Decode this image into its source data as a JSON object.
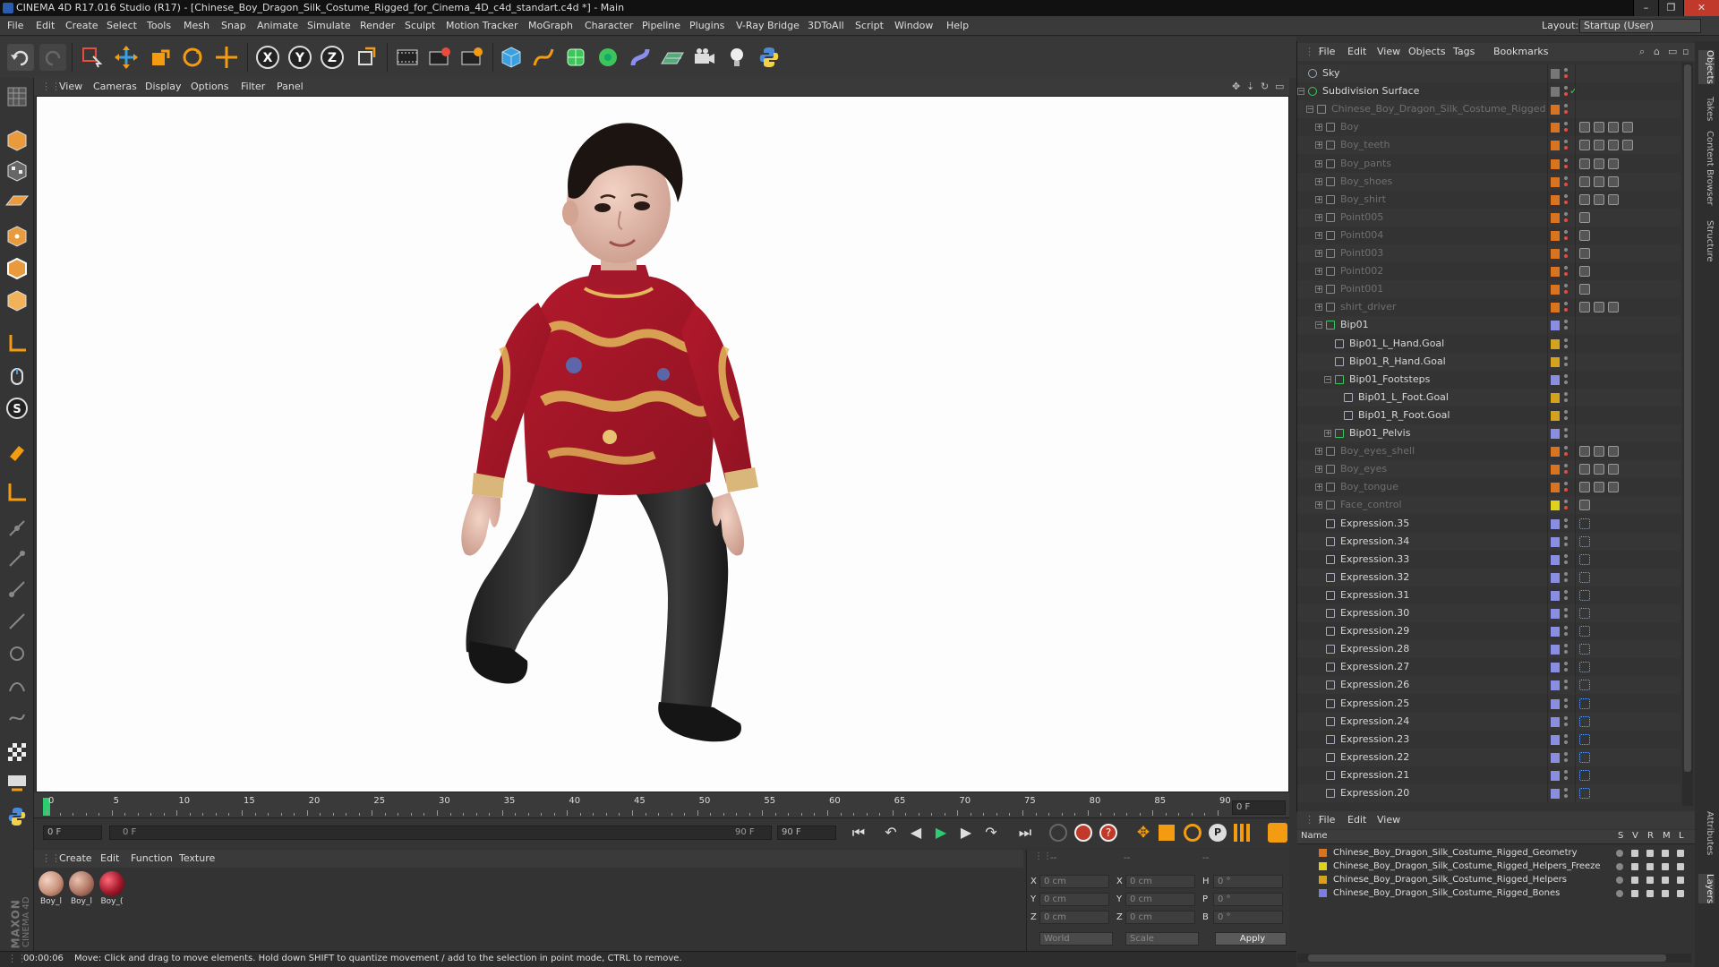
{
  "window": {
    "title": "CINEMA 4D R17.016 Studio (R17) - [Chinese_Boy_Dragon_Silk_Costume_Rigged_for_Cinema_4D_c4d_standart.c4d *] - Main",
    "minimize": "–",
    "maximize": "❐",
    "close": "✕"
  },
  "menubar": {
    "items": [
      "File",
      "Edit",
      "Create",
      "Select",
      "Tools",
      "Mesh",
      "Snap",
      "Animate",
      "Simulate",
      "Render",
      "Sculpt",
      "Motion Tracker",
      "MoGraph",
      "Character",
      "Pipeline",
      "Plugins",
      "V-Ray Bridge",
      "3DToAll",
      "Script",
      "Window",
      "Help"
    ],
    "layout_label": "Layout:",
    "layout_value": "Startup (User)"
  },
  "viewport": {
    "menu": [
      "View",
      "Cameras",
      "Display",
      "Options",
      "Filter",
      "Panel"
    ]
  },
  "timeline": {
    "ticks": [
      "0",
      "5",
      "10",
      "15",
      "20",
      "25",
      "30",
      "35",
      "40",
      "45",
      "50",
      "55",
      "60",
      "65",
      "70",
      "75",
      "80",
      "85",
      "90"
    ],
    "current_frame": "0 F",
    "start_field": "0 F",
    "range_start": "0 F",
    "range_end": "90 F",
    "end_field": "90 F"
  },
  "material_manager": {
    "menu": [
      "Create",
      "Edit",
      "Function",
      "Texture"
    ],
    "materials": [
      {
        "label": "Boy_l",
        "color": "#c8927a"
      },
      {
        "label": "Boy_l",
        "color": "#b07563"
      },
      {
        "label": "Boy_(",
        "color": "#a0182a"
      }
    ]
  },
  "coordinates": {
    "header_left": "--",
    "header_mid": "--",
    "header_right": "--",
    "rows": [
      {
        "a": "X",
        "av": "0 cm",
        "b": "X",
        "bv": "0 cm",
        "c": "H",
        "cv": "0 °"
      },
      {
        "a": "Y",
        "av": "0 cm",
        "b": "Y",
        "bv": "0 cm",
        "c": "P",
        "cv": "0 °"
      },
      {
        "a": "Z",
        "av": "0 cm",
        "b": "Z",
        "bv": "0 cm",
        "c": "B",
        "cv": "0 °"
      }
    ],
    "space": "World",
    "mode": "Scale",
    "apply": "Apply"
  },
  "status": {
    "time": "00:00:06",
    "message": "Move: Click and drag to move elements. Hold down SHIFT to quantize movement / add to the selection in point mode, CTRL to remove."
  },
  "brand": {
    "maxon": "MAXON",
    "cinema": "CINEMA 4D"
  },
  "object_manager": {
    "menu": [
      "File",
      "Edit",
      "View",
      "Objects",
      "Tags",
      "Bookmarks"
    ],
    "objects": [
      {
        "name": "Sky",
        "depth": 0,
        "dim": false,
        "exp": "",
        "color": "#9ab"
      },
      {
        "name": "Subdivision Surface",
        "depth": 0,
        "dim": false,
        "exp": "−",
        "color": "#3ec45c"
      },
      {
        "name": "Chinese_Boy_Dragon_Silk_Costume_Rigged",
        "depth": 1,
        "dim": true,
        "exp": "−",
        "color": "#888"
      },
      {
        "name": "Boy",
        "depth": 2,
        "dim": true,
        "exp": "+",
        "color": "#888"
      },
      {
        "name": "Boy_teeth",
        "depth": 2,
        "dim": true,
        "exp": "+",
        "color": "#888"
      },
      {
        "name": "Boy_pants",
        "depth": 2,
        "dim": true,
        "exp": "+",
        "color": "#888"
      },
      {
        "name": "Boy_shoes",
        "depth": 2,
        "dim": true,
        "exp": "+",
        "color": "#888"
      },
      {
        "name": "Boy_shirt",
        "depth": 2,
        "dim": true,
        "exp": "+",
        "color": "#888"
      },
      {
        "name": "Point005",
        "depth": 2,
        "dim": true,
        "exp": "+",
        "color": "#888"
      },
      {
        "name": "Point004",
        "depth": 2,
        "dim": true,
        "exp": "+",
        "color": "#888"
      },
      {
        "name": "Point003",
        "depth": 2,
        "dim": true,
        "exp": "+",
        "color": "#888"
      },
      {
        "name": "Point002",
        "depth": 2,
        "dim": true,
        "exp": "+",
        "color": "#888"
      },
      {
        "name": "Point001",
        "depth": 2,
        "dim": true,
        "exp": "+",
        "color": "#888"
      },
      {
        "name": "shirt_driver",
        "depth": 2,
        "dim": true,
        "exp": "+",
        "color": "#888"
      },
      {
        "name": "Bip01",
        "depth": 2,
        "dim": false,
        "exp": "−",
        "color": "#3ec45c"
      },
      {
        "name": "Bip01_L_Hand.Goal",
        "depth": 3,
        "dim": false,
        "exp": "",
        "color": "#aab"
      },
      {
        "name": "Bip01_R_Hand.Goal",
        "depth": 3,
        "dim": false,
        "exp": "",
        "color": "#aab"
      },
      {
        "name": "Bip01_Footsteps",
        "depth": 3,
        "dim": false,
        "exp": "−",
        "color": "#3ec45c"
      },
      {
        "name": "Bip01_L_Foot.Goal",
        "depth": 4,
        "dim": false,
        "exp": "",
        "color": "#aab"
      },
      {
        "name": "Bip01_R_Foot.Goal",
        "depth": 4,
        "dim": false,
        "exp": "",
        "color": "#aab"
      },
      {
        "name": "Bip01_Pelvis",
        "depth": 3,
        "dim": false,
        "exp": "+",
        "color": "#3ec45c"
      },
      {
        "name": "Boy_eyes_shell",
        "depth": 2,
        "dim": true,
        "exp": "+",
        "color": "#888"
      },
      {
        "name": "Boy_eyes",
        "depth": 2,
        "dim": true,
        "exp": "+",
        "color": "#888"
      },
      {
        "name": "Boy_tongue",
        "depth": 2,
        "dim": true,
        "exp": "+",
        "color": "#888"
      },
      {
        "name": "Face_control",
        "depth": 2,
        "dim": true,
        "exp": "+",
        "color": "#888"
      },
      {
        "name": "Expression.35",
        "depth": 2,
        "dim": false,
        "exp": "",
        "color": "#aab"
      },
      {
        "name": "Expression.34",
        "depth": 2,
        "dim": false,
        "exp": "",
        "color": "#aab"
      },
      {
        "name": "Expression.33",
        "depth": 2,
        "dim": false,
        "exp": "",
        "color": "#aab"
      },
      {
        "name": "Expression.32",
        "depth": 2,
        "dim": false,
        "exp": "",
        "color": "#aab"
      },
      {
        "name": "Expression.31",
        "depth": 2,
        "dim": false,
        "exp": "",
        "color": "#aab"
      },
      {
        "name": "Expression.30",
        "depth": 2,
        "dim": false,
        "exp": "",
        "color": "#aab"
      },
      {
        "name": "Expression.29",
        "depth": 2,
        "dim": false,
        "exp": "",
        "color": "#aab"
      },
      {
        "name": "Expression.28",
        "depth": 2,
        "dim": false,
        "exp": "",
        "color": "#aab"
      },
      {
        "name": "Expression.27",
        "depth": 2,
        "dim": false,
        "exp": "",
        "color": "#aab"
      },
      {
        "name": "Expression.26",
        "depth": 2,
        "dim": false,
        "exp": "",
        "color": "#aab"
      },
      {
        "name": "Expression.25",
        "depth": 2,
        "dim": false,
        "exp": "",
        "color": "#aab"
      },
      {
        "name": "Expression.24",
        "depth": 2,
        "dim": false,
        "exp": "",
        "color": "#aab"
      },
      {
        "name": "Expression.23",
        "depth": 2,
        "dim": false,
        "exp": "",
        "color": "#aab"
      },
      {
        "name": "Expression.22",
        "depth": 2,
        "dim": false,
        "exp": "",
        "color": "#aab"
      },
      {
        "name": "Expression.21",
        "depth": 2,
        "dim": false,
        "exp": "",
        "color": "#aab"
      },
      {
        "name": "Expression.20",
        "depth": 2,
        "dim": false,
        "exp": "",
        "color": "#aab"
      }
    ]
  },
  "layer_manager": {
    "menu": [
      "File",
      "Edit",
      "View"
    ],
    "columns": {
      "name": "Name",
      "s": "S",
      "v": "V",
      "r": "R",
      "m": "M",
      "l": "L"
    },
    "layers": [
      {
        "name": "Chinese_Boy_Dragon_Silk_Costume_Rigged_Geometry",
        "color": "#d9731f"
      },
      {
        "name": "Chinese_Boy_Dragon_Silk_Costume_Rigged_Helpers_Freeze",
        "color": "#e0d21a"
      },
      {
        "name": "Chinese_Boy_Dragon_Silk_Costume_Rigged_Helpers",
        "color": "#d4a21c"
      },
      {
        "name": "Chinese_Boy_Dragon_Silk_Costume_Rigged_Bones",
        "color": "#7a7ee0"
      }
    ]
  },
  "right_tabs": [
    "Objects",
    "Takes",
    "Content Browser",
    "Structure",
    "Attributes",
    "Layers"
  ]
}
